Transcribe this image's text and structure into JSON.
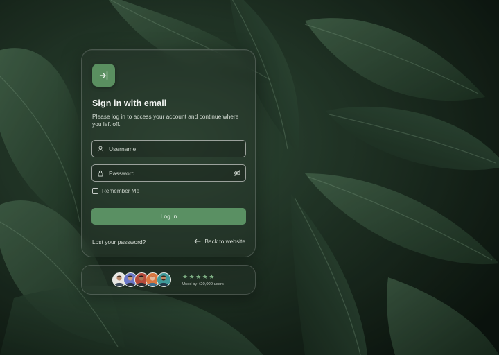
{
  "login": {
    "title": "Sign in with email",
    "subtitle": "Please log in to access your account and continue where you left off.",
    "username_placeholder": "Username",
    "password_placeholder": "Password",
    "remember_label": "Remember Me",
    "login_button": "Log In",
    "lost_password": "Lost your password?",
    "back_link": "Back to website"
  },
  "social_proof": {
    "rating_stars": 5,
    "used_by": "Used by +20,000 users"
  },
  "icons": {
    "logo": "login-arrow-icon",
    "username": "user-icon",
    "password": "lock-icon",
    "toggle_password": "eye-off-icon",
    "back": "arrow-left-icon",
    "star": "star-icon"
  },
  "colors": {
    "accent": "#5a9063",
    "logo_bg": "#5a8f60",
    "star": "#7fb084"
  }
}
